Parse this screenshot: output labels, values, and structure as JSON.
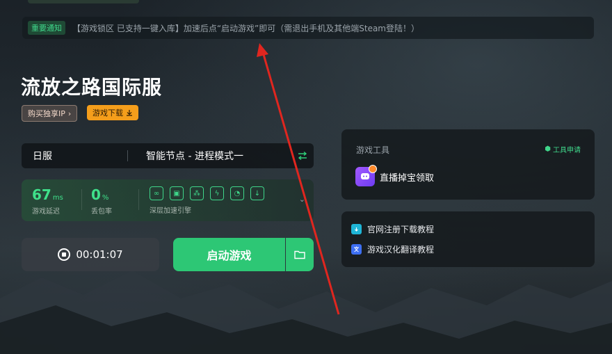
{
  "notice": {
    "tag": "重要通知",
    "text": "【游戏锁区 已支持一键入库】加速后点“启动游戏”即可（需退出手机及其他端Steam登陆！）"
  },
  "game": {
    "title": "流放之路国际服",
    "buy_ip_label": "购买独享IP",
    "download_label": "游戏下载"
  },
  "server": {
    "region": "日服",
    "node": "智能节点 - 进程模式一"
  },
  "stats": {
    "latency_value": "67",
    "latency_unit": "ms",
    "latency_label": "游戏延迟",
    "loss_value": "0",
    "loss_unit": "%",
    "loss_label": "丢包率",
    "accel_label": "深层加速引擎"
  },
  "timer": {
    "value": "00:01:07"
  },
  "launch": {
    "label": "启动游戏"
  },
  "tools": {
    "heading": "游戏工具",
    "apply_label": "工具申请",
    "item_label": "直播掉宝领取"
  },
  "tutorials": {
    "items": [
      {
        "label": "官网注册下载教程"
      },
      {
        "label": "游戏汉化翻译教程"
      }
    ]
  },
  "colors": {
    "accent": "#2dc775",
    "warning": "#f59e1b",
    "annotation_arrow": "#e0261f"
  }
}
